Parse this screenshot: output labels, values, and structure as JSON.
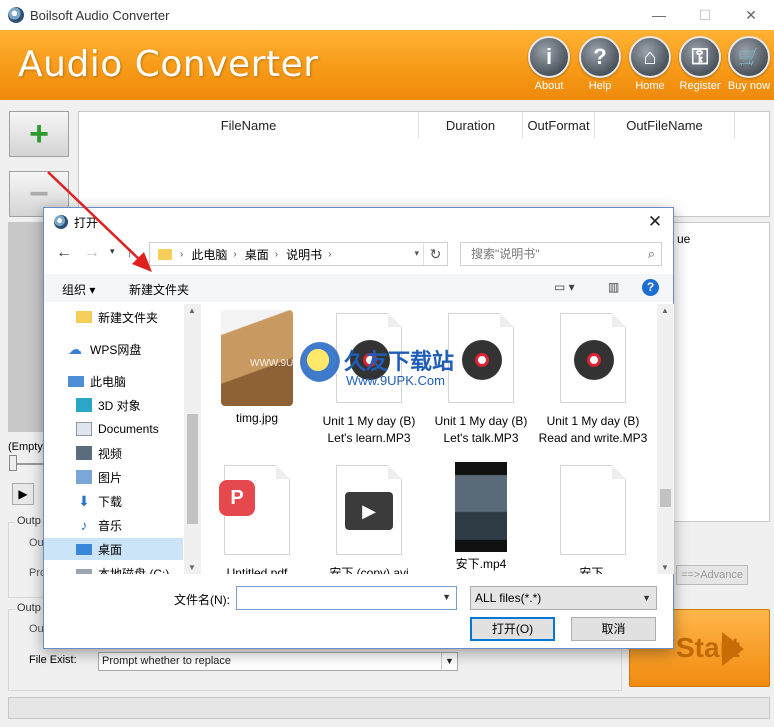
{
  "window": {
    "title": "Boilsoft Audio Converter",
    "minimize_icon": "minimize-icon",
    "maximize_icon": "maximize-icon",
    "close_icon": "close-icon"
  },
  "banner": {
    "app_name": "Audio Converter",
    "buttons": [
      {
        "label": "About",
        "glyph": "i"
      },
      {
        "label": "Help",
        "glyph": "?"
      },
      {
        "label": "Home",
        "glyph": "⌂"
      },
      {
        "label": "Register",
        "glyph": "⚿"
      },
      {
        "label": "Buy now",
        "glyph": "🛒"
      }
    ]
  },
  "file_table": {
    "columns": [
      "FileName",
      "Duration",
      "OutFormat",
      "OutFileName"
    ]
  },
  "right_panel": {
    "partial_text": "ue"
  },
  "player": {
    "status": "(Empty)"
  },
  "groups": {
    "output1_caption": "Outp",
    "output1_fragments": [
      "Ou",
      "Pro"
    ],
    "output2_caption": "Outp",
    "output2_fragment": "Ou"
  },
  "advance_button": "==>Advance",
  "file_exist": {
    "label": "File Exist:",
    "value": "Prompt whether to replace"
  },
  "start_button": "Start",
  "dialog": {
    "title": "打开",
    "address": {
      "segments": [
        "此电脑",
        "桌面",
        "说明书"
      ]
    },
    "search_placeholder": "搜索\"说明书\"",
    "toolbar": {
      "organize": "组织 ▾",
      "new_folder": "新建文件夹"
    },
    "nav_items": [
      {
        "label": "新建文件夹",
        "icon": "folder-icon"
      },
      {
        "label": "WPS网盘",
        "icon": "cloud-icon"
      },
      {
        "label": "此电脑",
        "icon": "computer-icon"
      },
      {
        "label": "3D 对象",
        "icon": "3d-objects-icon"
      },
      {
        "label": "Documents",
        "icon": "documents-icon"
      },
      {
        "label": "视频",
        "icon": "video-icon"
      },
      {
        "label": "图片",
        "icon": "pictures-icon"
      },
      {
        "label": "下载",
        "icon": "download-icon"
      },
      {
        "label": "音乐",
        "icon": "music-icon"
      },
      {
        "label": "桌面",
        "icon": "desktop-icon"
      },
      {
        "label": "本地磁盘 (C:)",
        "icon": "disk-icon"
      }
    ],
    "files": [
      {
        "name": "timg.jpg",
        "kind": "image"
      },
      {
        "name": "Unit 1 My day (B)   Let's learn.MP3",
        "kind": "audio"
      },
      {
        "name": "Unit 1 My day (B)   Let's talk.MP3",
        "kind": "audio"
      },
      {
        "name": "Unit 1 My day (B)   Read and write.MP3",
        "kind": "audio"
      },
      {
        "name": "Untitled.pdf",
        "kind": "pdf"
      },
      {
        "name": "安下 (copy).avi",
        "kind": "video"
      },
      {
        "name": "安下.mp4",
        "kind": "video-thumb"
      },
      {
        "name": "安下.",
        "kind": "blank"
      }
    ],
    "filename_label": "文件名(N):",
    "filename_value": "",
    "filetype_value": "ALL files(*.*)",
    "open_button": "打开(O)",
    "cancel_button": "取消"
  },
  "watermark": {
    "brand": "久友下载站",
    "url": "Www.9UPK.Com",
    "small": "WWW.9UPK.COM"
  }
}
